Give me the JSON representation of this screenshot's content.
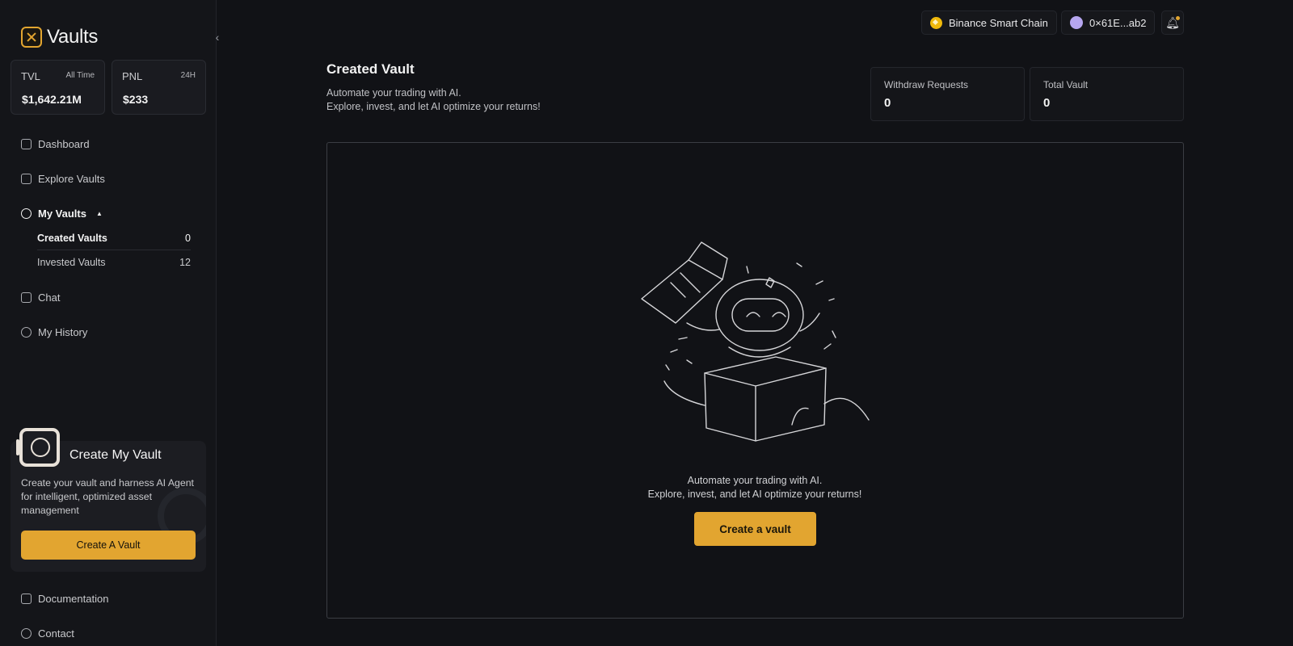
{
  "app": {
    "logo_text": "Vaults"
  },
  "stats": [
    {
      "label": "TVL",
      "tag": "All Time",
      "value": "$1,642.21M"
    },
    {
      "label": "PNL",
      "tag": "24H",
      "value": "$233"
    }
  ],
  "nav": {
    "dashboard": "Dashboard",
    "explore": "Explore Vaults",
    "my_vaults": "My Vaults",
    "created_vaults": {
      "label": "Created Vaults",
      "count": "0"
    },
    "invested_vaults": {
      "label": "Invested Vaults",
      "count": "12"
    },
    "chat": "Chat",
    "history": "My History",
    "documentation": "Documentation",
    "contact": "Contact"
  },
  "promo": {
    "title": "Create My Vault",
    "text": "Create your vault and harness AI Agent for intelligent, optimized asset management",
    "button": "Create A Vault"
  },
  "topbar": {
    "network": "Binance Smart Chain",
    "wallet": "0×61E...ab2"
  },
  "main": {
    "title": "Created Vault",
    "subtitle_line1": "Automate your trading with AI.",
    "subtitle_line2": "Explore, invest, and let AI optimize your returns!",
    "metrics": [
      {
        "label": "Withdraw Requests",
        "value": "0"
      },
      {
        "label": "Total Vault",
        "value": "0"
      }
    ],
    "empty_line1": "Automate your trading with AI.",
    "empty_line2": "Explore, invest, and let AI optimize your returns!",
    "cta": "Create a vault"
  },
  "colors": {
    "accent": "#e2a530",
    "background": "#111216",
    "sidebar": "#141519"
  }
}
